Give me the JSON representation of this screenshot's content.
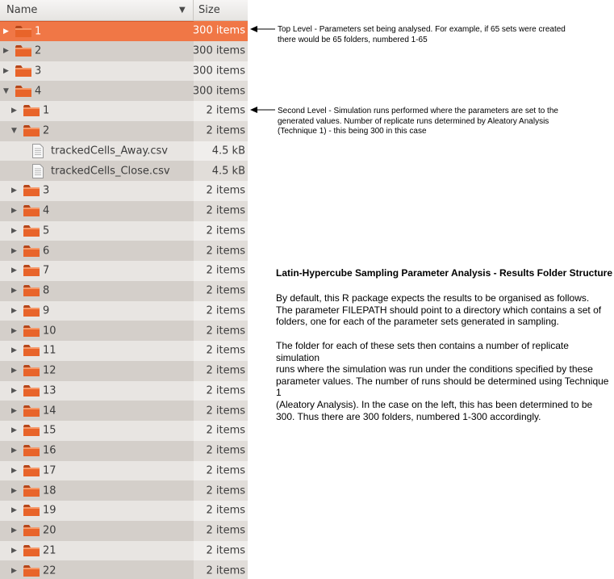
{
  "header": {
    "name_label": "Name",
    "size_label": "Size"
  },
  "rows": [
    {
      "level": 0,
      "type": "folder",
      "expander": "collapsed",
      "name": "1",
      "size": "300 items",
      "selected": true
    },
    {
      "level": 0,
      "type": "folder",
      "expander": "collapsed",
      "name": "2",
      "size": "300 items"
    },
    {
      "level": 0,
      "type": "folder",
      "expander": "collapsed",
      "name": "3",
      "size": "300 items"
    },
    {
      "level": 0,
      "type": "folder",
      "expander": "expanded",
      "name": "4",
      "size": "300 items"
    },
    {
      "level": 1,
      "type": "folder",
      "expander": "collapsed",
      "name": "1",
      "size": "2 items"
    },
    {
      "level": 1,
      "type": "folder",
      "expander": "expanded",
      "name": "2",
      "size": "2 items"
    },
    {
      "level": 2,
      "type": "file",
      "name": "trackedCells_Away.csv",
      "size": "4.5 kB"
    },
    {
      "level": 2,
      "type": "file",
      "name": "trackedCells_Close.csv",
      "size": "4.5 kB"
    },
    {
      "level": 1,
      "type": "folder",
      "expander": "collapsed",
      "name": "3",
      "size": "2 items"
    },
    {
      "level": 1,
      "type": "folder",
      "expander": "collapsed",
      "name": "4",
      "size": "2 items"
    },
    {
      "level": 1,
      "type": "folder",
      "expander": "collapsed",
      "name": "5",
      "size": "2 items"
    },
    {
      "level": 1,
      "type": "folder",
      "expander": "collapsed",
      "name": "6",
      "size": "2 items"
    },
    {
      "level": 1,
      "type": "folder",
      "expander": "collapsed",
      "name": "7",
      "size": "2 items"
    },
    {
      "level": 1,
      "type": "folder",
      "expander": "collapsed",
      "name": "8",
      "size": "2 items"
    },
    {
      "level": 1,
      "type": "folder",
      "expander": "collapsed",
      "name": "9",
      "size": "2 items"
    },
    {
      "level": 1,
      "type": "folder",
      "expander": "collapsed",
      "name": "10",
      "size": "2 items"
    },
    {
      "level": 1,
      "type": "folder",
      "expander": "collapsed",
      "name": "11",
      "size": "2 items"
    },
    {
      "level": 1,
      "type": "folder",
      "expander": "collapsed",
      "name": "12",
      "size": "2 items"
    },
    {
      "level": 1,
      "type": "folder",
      "expander": "collapsed",
      "name": "13",
      "size": "2 items"
    },
    {
      "level": 1,
      "type": "folder",
      "expander": "collapsed",
      "name": "14",
      "size": "2 items"
    },
    {
      "level": 1,
      "type": "folder",
      "expander": "collapsed",
      "name": "15",
      "size": "2 items"
    },
    {
      "level": 1,
      "type": "folder",
      "expander": "collapsed",
      "name": "16",
      "size": "2 items"
    },
    {
      "level": 1,
      "type": "folder",
      "expander": "collapsed",
      "name": "17",
      "size": "2 items"
    },
    {
      "level": 1,
      "type": "folder",
      "expander": "collapsed",
      "name": "18",
      "size": "2 items"
    },
    {
      "level": 1,
      "type": "folder",
      "expander": "collapsed",
      "name": "19",
      "size": "2 items"
    },
    {
      "level": 1,
      "type": "folder",
      "expander": "collapsed",
      "name": "20",
      "size": "2 items"
    },
    {
      "level": 1,
      "type": "folder",
      "expander": "collapsed",
      "name": "21",
      "size": "2 items"
    },
    {
      "level": 1,
      "type": "folder",
      "expander": "collapsed",
      "name": "22",
      "size": "2 items"
    }
  ],
  "annotations": {
    "top_level": [
      "Top Level - Parameters set being analysed. For example, if 65 sets were created",
      "there would be 65 folders, numbered 1-65"
    ],
    "second_level": [
      "Second Level - Simulation runs performed where the parameters are set to the",
      "generated values.  Number of replicate runs determined by Aleatory Analysis",
      "(Technique 1) - this being 300 in this case"
    ],
    "title": "Latin-Hypercube Sampling Parameter Analysis - Results Folder Structure",
    "para1": [
      "By default, this R package expects the results to be organised as follows.",
      "The parameter FILEPATH should point to a directory which contains a set of",
      "folders, one for each of the parameter sets generated in sampling."
    ],
    "para2": [
      "The folder for each of these sets then contains a number of replicate simulation",
      "runs where the simulation was run under the conditions specified by these",
      "parameter values. The number of runs should be determined using Technique 1",
      "(Aleatory Analysis).  In the case on the left, this has been determined to be",
      "300. Thus there are 300 folders, numbered 1-300 accordingly."
    ]
  },
  "colors": {
    "selection": "#f07746",
    "folder": "#e8642a"
  },
  "icons": {
    "folder": "folder-icon",
    "file": "text-file-icon",
    "expander_collapsed": "triangle-right-icon",
    "expander_expanded": "triangle-down-icon",
    "sort": "sort-arrow-down-icon"
  }
}
